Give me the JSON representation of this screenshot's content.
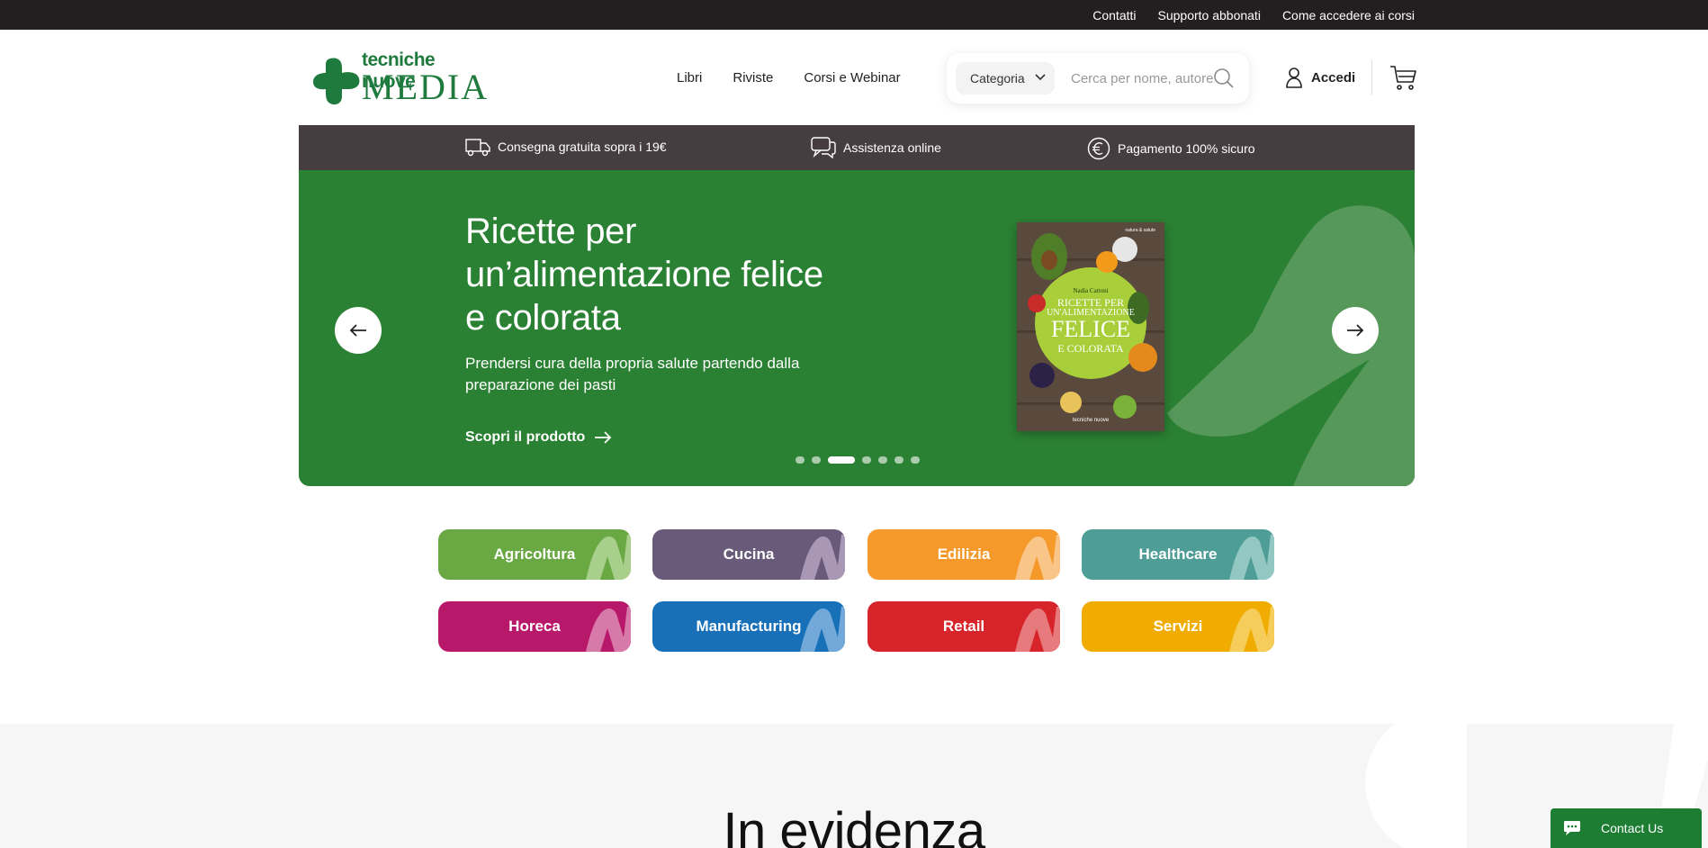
{
  "topbar": {
    "links": [
      "Contatti",
      "Supporto abbonati",
      "Come accedere ai corsi"
    ]
  },
  "logo": {
    "line1": "tecniche nuove",
    "line2": "MEDIA"
  },
  "nav": {
    "items": [
      "Libri",
      "Riviste",
      "Corsi e Webinar"
    ]
  },
  "search": {
    "category_label": "Categoria",
    "placeholder": "Cerca per nome, autore..."
  },
  "account": {
    "login_label": "Accedi"
  },
  "features": [
    {
      "icon": "truck-icon",
      "label": "Consegna gratuita sopra i 19€"
    },
    {
      "icon": "chat-icon",
      "label": "Assistenza online"
    },
    {
      "icon": "euro-icon",
      "label": "Pagamento 100% sicuro"
    }
  ],
  "hero": {
    "title": "Ricette per un’alimentazione felice e colorata",
    "subtitle": "Prendersi cura della propria salute partendo dalla preparazione dei pasti",
    "cta": "Scopri il prodotto",
    "book": {
      "publisher": "natura & salute",
      "author": "Nadia Cattoni",
      "cover_title_1": "RICETTE PER",
      "cover_title_2": "UN'ALIMENTAZIONE",
      "cover_title_3": "FELICE",
      "cover_title_4": "E COLORATA",
      "brand": "tecniche nuove"
    },
    "slides_total": 7,
    "active_slide": 3
  },
  "categories": [
    {
      "label": "Agricoltura",
      "color": "#6aa843",
      "accent": "#a9cf8d"
    },
    {
      "label": "Cucina",
      "color": "#6a5a7a",
      "accent": "#a898b5"
    },
    {
      "label": "Edilizia",
      "color": "#f59a2a",
      "accent": "#f9c589"
    },
    {
      "label": "Healthcare",
      "color": "#4e9e97",
      "accent": "#93c7c2"
    },
    {
      "label": "Horeca",
      "color": "#b8186a",
      "accent": "#d77aa9"
    },
    {
      "label": "Manufacturing",
      "color": "#1871b8",
      "accent": "#72a9d9"
    },
    {
      "label": "Retail",
      "color": "#d6242a",
      "accent": "#e77a7d"
    },
    {
      "label": "Servizi",
      "color": "#f0ac00",
      "accent": "#f6cd5b"
    }
  ],
  "section": {
    "title": "In evidenza"
  },
  "chat": {
    "label": "Contact Us"
  },
  "colors": {
    "brand_green": "#1f7a3d",
    "hero_green": "#2b8133",
    "strip_bg": "#463d40",
    "topbar_bg": "#231f20"
  }
}
